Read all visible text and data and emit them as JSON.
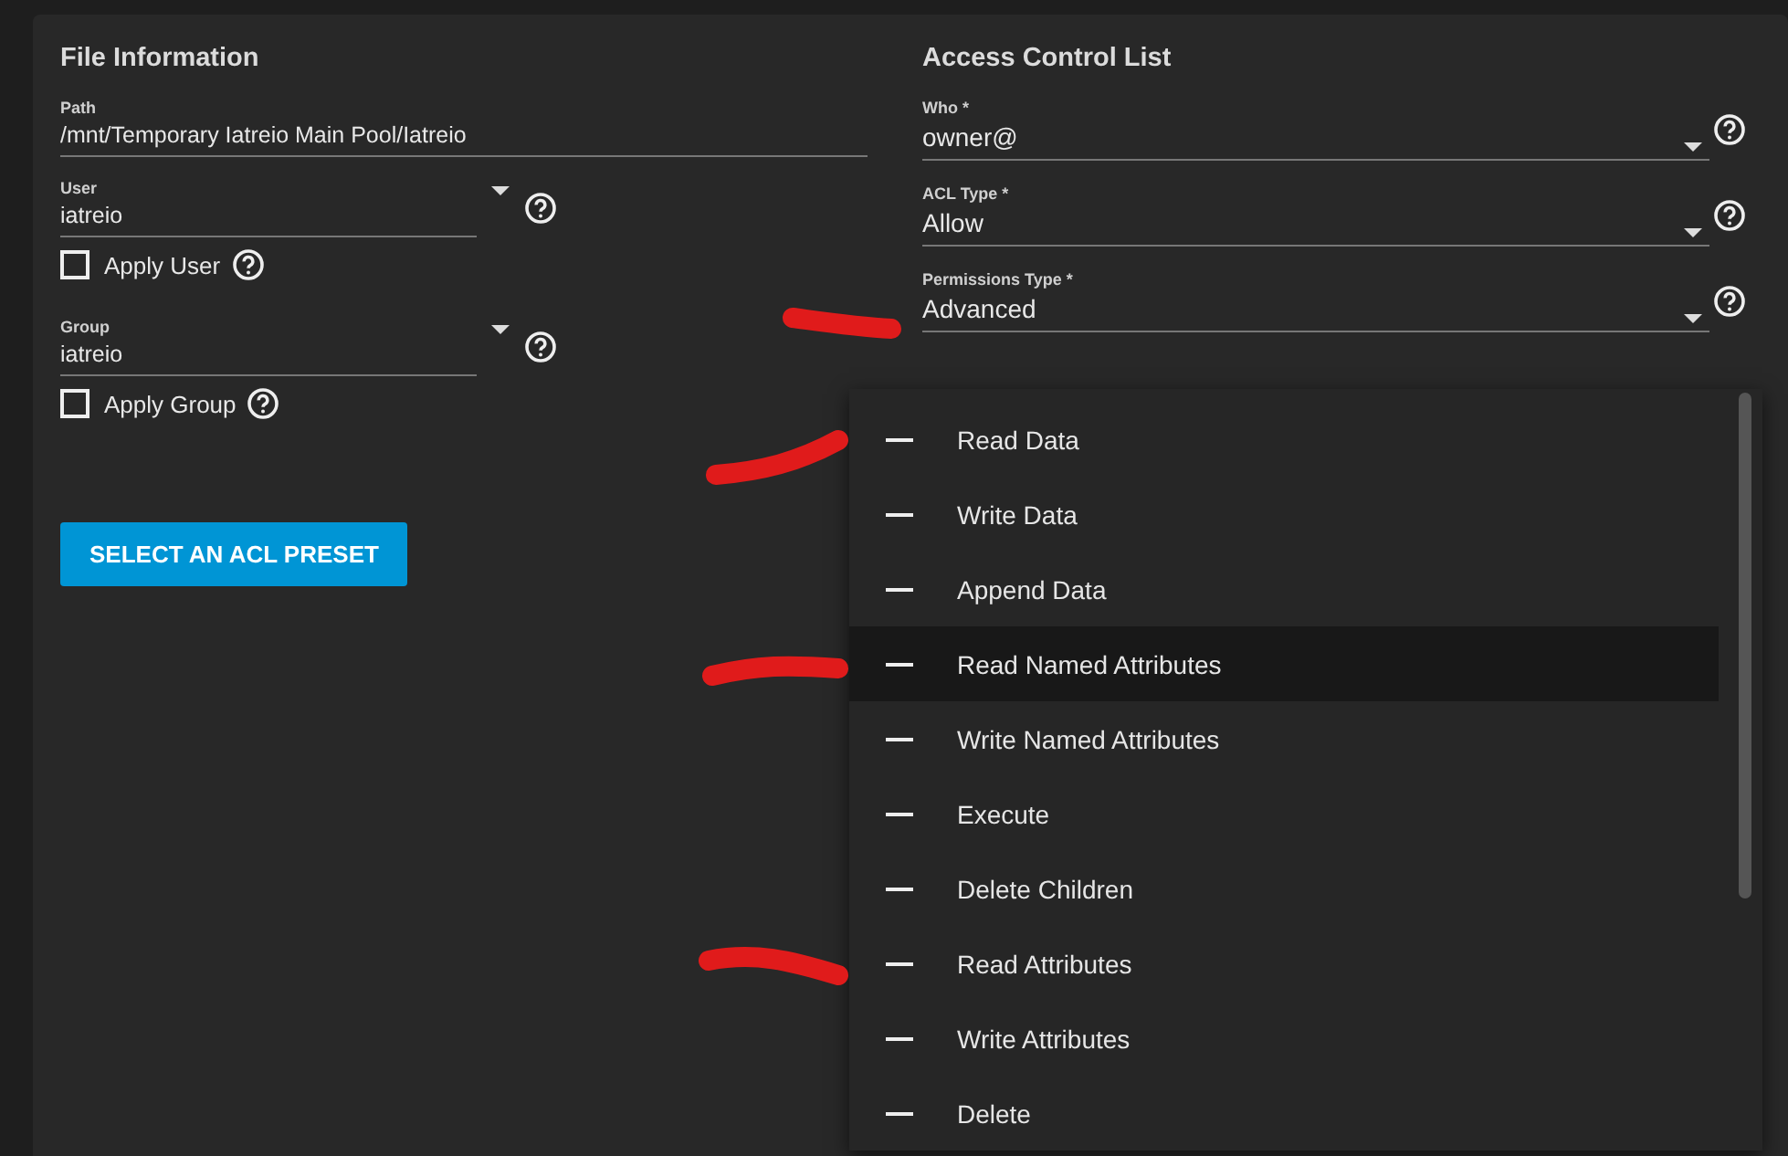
{
  "file_information": {
    "title": "File Information",
    "path": {
      "label": "Path",
      "value": "/mnt/Temporary Iatreio Main Pool/Iatreio"
    },
    "user": {
      "label": "User",
      "value": "iatreio"
    },
    "apply_user": {
      "label": "Apply User",
      "checked": false
    },
    "group": {
      "label": "Group",
      "value": "iatreio"
    },
    "apply_group": {
      "label": "Apply Group",
      "checked": false
    },
    "preset_button": "SELECT AN ACL PRESET"
  },
  "access_control_list": {
    "title": "Access Control List",
    "fields": [
      {
        "label": "Who *",
        "value": "owner@"
      },
      {
        "label": "ACL Type *",
        "value": "Allow"
      },
      {
        "label": "Permissions Type *",
        "value": "Advanced"
      }
    ]
  },
  "permissions_menu": {
    "items": [
      {
        "label": "Read Data",
        "highlighted": false
      },
      {
        "label": "Write Data",
        "highlighted": false
      },
      {
        "label": "Append Data",
        "highlighted": false
      },
      {
        "label": "Read Named Attributes",
        "highlighted": true
      },
      {
        "label": "Write Named Attributes",
        "highlighted": false
      },
      {
        "label": "Execute",
        "highlighted": false
      },
      {
        "label": "Delete Children",
        "highlighted": false
      },
      {
        "label": "Read Attributes",
        "highlighted": false
      },
      {
        "label": "Write Attributes",
        "highlighted": false
      },
      {
        "label": "Delete",
        "highlighted": false
      }
    ]
  }
}
